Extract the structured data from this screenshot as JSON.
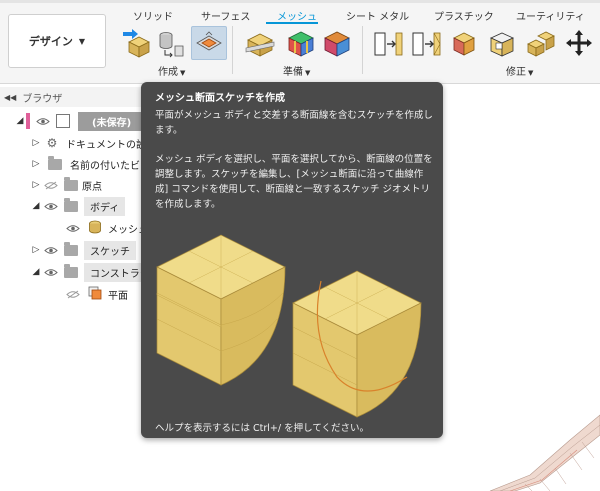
{
  "ribbon": {
    "workspace_label": "デザイン",
    "tabs": [
      "ソリッド",
      "サーフェス",
      "メッシュ",
      "シート メタル",
      "プラスチック",
      "ユーティリティ"
    ],
    "active_tab": "メッシュ",
    "groups": {
      "create": "作成",
      "prepare": "準備",
      "modify": "修正"
    },
    "accent_color": "#0696d7"
  },
  "browser": {
    "title": "ブラウザ",
    "root": "(未保存)",
    "items": [
      "ドキュメントの設定",
      "名前の付いたビ",
      "原点",
      "ボディ",
      "メッシュ",
      "スケッチ",
      "コンストラク",
      "平面"
    ]
  },
  "tooltip": {
    "title": "メッシュ断面スケッチを作成",
    "paragraph1": "平面がメッシュ ボディと交差する断面線を含むスケッチを作成します。",
    "paragraph2": "メッシュ ボディを選択し、平面を選択してから、断面線の位置を調整します。スケッチを編集し、[メッシュ断面に沿って曲線作成] コマンドを使用して、断面線と一致するスケッチ ジオメトリを作成します。",
    "help": "ヘルプを表示するには Ctrl+/ を押してください。",
    "background_color": "#4a4a4a",
    "illustration_color": "#e8cd78",
    "section_line_color": "#d9822b"
  }
}
